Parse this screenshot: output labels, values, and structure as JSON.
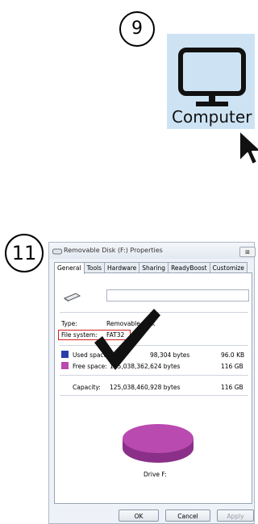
{
  "steps": {
    "first": "9",
    "second": "11"
  },
  "desktop": {
    "computer_label": "Computer"
  },
  "dialog": {
    "title": "Removable Disk (F:) Properties",
    "close_glyph": "⊠",
    "tabs": [
      "General",
      "Tools",
      "Hardware",
      "Sharing",
      "ReadyBoost",
      "Customize"
    ],
    "active_tab": "General",
    "type_label": "Type:",
    "type_value": "Removable Disk",
    "fs_label": "File system:",
    "fs_value": "FAT32",
    "used_label": "Used space:",
    "used_bytes": "98,304 bytes",
    "used_size": "96.0 KB",
    "free_label": "Free space:",
    "free_bytes": "125,038,362,624 bytes",
    "free_size": "116 GB",
    "capacity_label": "Capacity:",
    "capacity_bytes": "125,038,460,928 bytes",
    "capacity_size": "116 GB",
    "drive_label": "Drive F:",
    "buttons": {
      "ok": "OK",
      "cancel": "Cancel",
      "apply": "Apply"
    }
  },
  "colors": {
    "used": "#2a3fa8",
    "free": "#b94ab0",
    "highlight_box": "#d21f1f",
    "tile": "#cde3f4"
  }
}
